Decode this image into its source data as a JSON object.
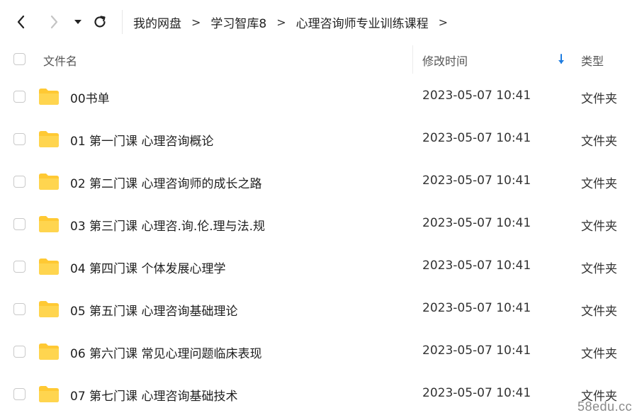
{
  "toolbar": {
    "back_icon": "chevron-left-icon",
    "forward_icon": "chevron-right-icon",
    "history_icon": "caret-down-icon",
    "refresh_icon": "refresh-icon"
  },
  "breadcrumb": {
    "items": [
      "我的网盘",
      "学习智库8",
      "心理咨询师专业训练课程"
    ],
    "separator": ">"
  },
  "header": {
    "name_label": "文件名",
    "time_label": "修改时间",
    "type_label": "类型",
    "sort_icon": "arrow-down-icon",
    "sort_color": "#1e7ce0"
  },
  "folder_color": "#ffc933",
  "files": [
    {
      "name": "00书单",
      "time": "2023-05-07 10:41",
      "type": "文件夹"
    },
    {
      "name": "01 第一门课 心理咨询概论",
      "time": "2023-05-07 10:41",
      "type": "文件夹"
    },
    {
      "name": "02 第二门课 心理咨询师的成长之路",
      "time": "2023-05-07 10:41",
      "type": "文件夹"
    },
    {
      "name": "03 第三门课 心理咨.询.伦.理与法.规",
      "time": "2023-05-07 10:41",
      "type": "文件夹"
    },
    {
      "name": "04 第四门课 个体发展心理学",
      "time": "2023-05-07 10:41",
      "type": "文件夹"
    },
    {
      "name": "05 第五门课 心理咨询基础理论",
      "time": "2023-05-07 10:41",
      "type": "文件夹"
    },
    {
      "name": "06 第六门课 常见心理问题临床表现",
      "time": "2023-05-07 10:41",
      "type": "文件夹"
    },
    {
      "name": "07 第七门课 心理咨询基础技术",
      "time": "2023-05-07 10:41",
      "type": "文件夹"
    }
  ],
  "watermark": "58edu.cc"
}
